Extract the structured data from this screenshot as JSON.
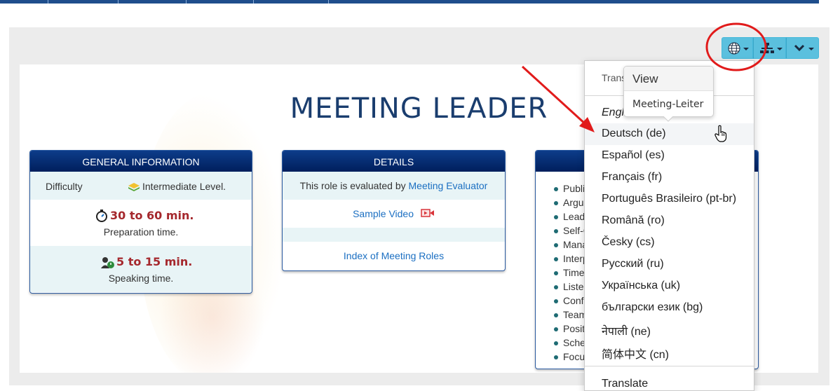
{
  "page": {
    "title": "MEETING LEADER"
  },
  "cards": {
    "general": {
      "heading": "GENERAL INFORMATION",
      "difficulty_label": "Difficulty",
      "difficulty_value": "Intermediate Level.",
      "prep_time": "30 to 60 min.",
      "prep_caption": "Preparation time.",
      "speak_time": "5 to 15 min.",
      "speak_caption": "Speaking time."
    },
    "details": {
      "heading": "DETAILS",
      "evaluated_prefix": "This role is evaluated by",
      "evaluator_link": "Meeting Evaluator",
      "sample_video": "Sample Video",
      "index_link": "Index of Meeting Roles"
    },
    "skills": {
      "items": [
        "Publi",
        "Argu",
        "Leade",
        "Self-C",
        "Mana",
        "Interp",
        "Time",
        "Listen",
        "Confi",
        "Team",
        "Posit",
        "Sched",
        "Focus"
      ]
    }
  },
  "toolbar": {
    "language_icon": "globe-icon",
    "sitemap_icon": "sitemap-icon",
    "more_icon": "chevron-down-icon",
    "accent": "#5bc0de"
  },
  "language_menu": {
    "header": "Trans",
    "current": "Engli",
    "items": [
      "Deutsch (de)",
      "Español (es)",
      "Français (fr)",
      "Português Brasileiro (pt-br)",
      "Română (ro)",
      "Česky (cs)",
      "Русский (ru)",
      "Українська (uk)",
      "български език (bg)",
      "नेपाली (ne)",
      "简体中文 (cn)"
    ],
    "footer": "Translate"
  },
  "tooltip": {
    "view": "View",
    "label": "Meeting-Leiter"
  },
  "annotation": {
    "color": "#e11b1b"
  }
}
